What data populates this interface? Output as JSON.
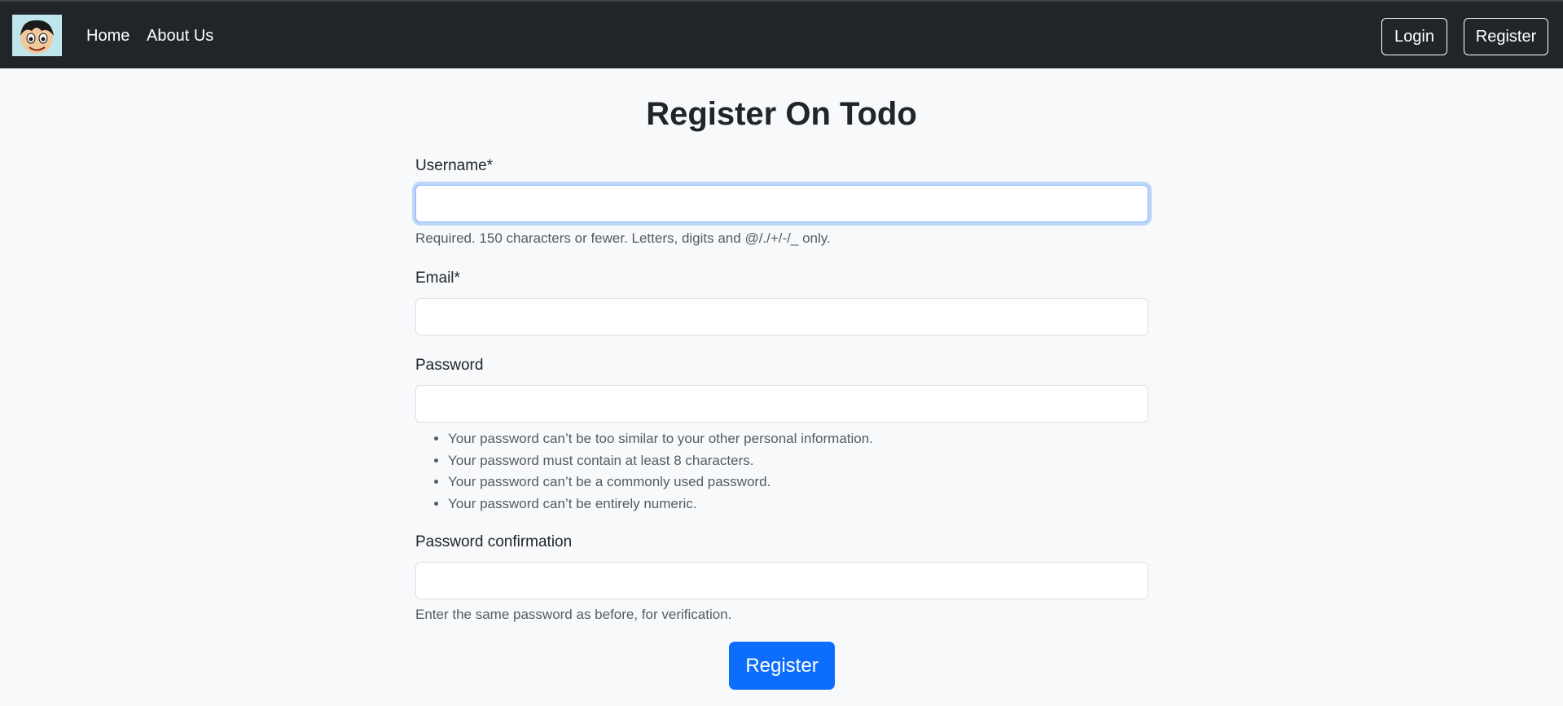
{
  "nav": {
    "links": [
      "Home",
      "About Us"
    ],
    "login_label": "Login",
    "register_label": "Register"
  },
  "page": {
    "title": "Register On Todo"
  },
  "form": {
    "username": {
      "label": "Username*",
      "value": "",
      "help": "Required. 150 characters or fewer. Letters, digits and @/./+/-/_ only."
    },
    "email": {
      "label": "Email*",
      "value": ""
    },
    "password": {
      "label": "Password",
      "value": "",
      "help_items": [
        "Your password can’t be too similar to your other personal information.",
        "Your password must contain at least 8 characters.",
        "Your password can’t be a commonly used password.",
        "Your password can’t be entirely numeric."
      ]
    },
    "password_confirmation": {
      "label": "Password confirmation",
      "value": "",
      "help": "Enter the same password as before, for verification."
    },
    "submit_label": "Register"
  },
  "colors": {
    "navbar": "#212529",
    "background": "#f8f9fa",
    "primary": "#0d6efd"
  }
}
